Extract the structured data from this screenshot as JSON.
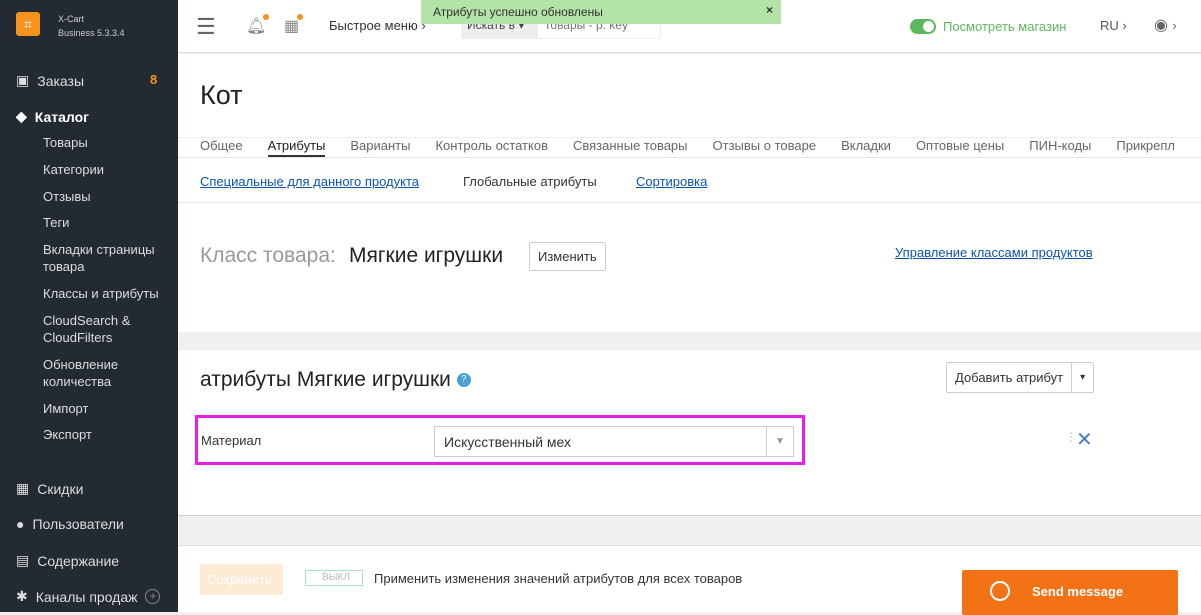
{
  "app": {
    "logo_text": "X-Cart",
    "version": "Business 5.3.3.4"
  },
  "sidebar": {
    "orders": "Заказы",
    "orders_count": "8",
    "catalog": "Каталог",
    "catalog_items": [
      "Товары",
      "Категории",
      "Отзывы",
      "Теги",
      "Вкладки страницы товара",
      "Классы и атрибуты",
      "CloudSearch & CloudFilters",
      "Обновление количества",
      "Импорт",
      "Экспорт"
    ],
    "discounts": "Скидки",
    "users": "Пользователи",
    "content": "Содержание",
    "sales_channels": "Каналы продаж"
  },
  "topbar": {
    "quick_menu": "Быстрое меню ›",
    "search_scope": "Искать в",
    "search_placeholder": "Товары - р. key",
    "view_store": "Посмотреть магазин",
    "lang": "RU ›",
    "user_chevron": "›"
  },
  "toast": {
    "text": "Атрибуты успешно обновлены",
    "close": "×"
  },
  "page": {
    "title": "Кот",
    "tabs": [
      "Общее",
      "Атрибуты",
      "Варианты",
      "Контроль остатков",
      "Связанные товары",
      "Отзывы о товаре",
      "Вкладки",
      "Оптовые цены",
      "ПИН-коды",
      "Прикрепл"
    ],
    "subtabs": [
      "Специальные для данного продукта",
      "Глобальные атрибуты",
      "Сортировка"
    ],
    "class_label": "Класс товара:",
    "class_value": "Мягкие игрушки",
    "change_button": "Изменить",
    "manage_classes": "Управление классами продуктов"
  },
  "attributes": {
    "heading": "атрибуты Мягкие игрушки",
    "add_button": "Добавить атрибут",
    "rows": [
      {
        "name": "Материал",
        "value": "Искусственный мех"
      }
    ]
  },
  "footer": {
    "save": "Сохранить",
    "toggle": "ВЫКЛ",
    "apply_all": "Применить изменения значений атрибутов для всех товаров",
    "send_message": "Send message"
  },
  "colors": {
    "accent": "#f6921e",
    "highlight": "#e91ee6",
    "green": "#5cb85c"
  }
}
